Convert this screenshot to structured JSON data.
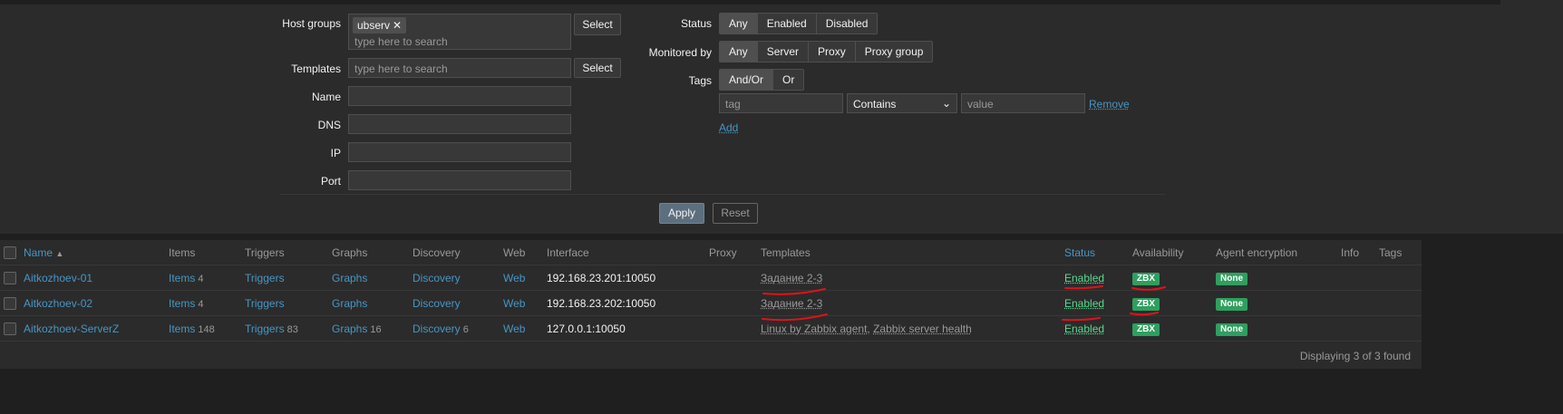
{
  "filter": {
    "host_groups_label": "Host groups",
    "host_group_chip": "ubserv",
    "chip_remove": "✕",
    "host_groups_placeholder": "type here to search",
    "templates_label": "Templates",
    "templates_placeholder": "type here to search",
    "select_label": "Select",
    "name_label": "Name",
    "dns_label": "DNS",
    "ip_label": "IP",
    "port_label": "Port",
    "status_label": "Status",
    "status_options": [
      "Any",
      "Enabled",
      "Disabled"
    ],
    "status_selected": "Any",
    "monitored_by_label": "Monitored by",
    "monitored_options": [
      "Any",
      "Server",
      "Proxy",
      "Proxy group"
    ],
    "monitored_selected": "Any",
    "tags_label": "Tags",
    "tags_options": [
      "And/Or",
      "Or"
    ],
    "tags_selected": "And/Or",
    "tag_placeholder": "tag",
    "tag_operator": "Contains",
    "value_placeholder": "value",
    "remove_label": "Remove",
    "add_label": "Add",
    "apply_label": "Apply",
    "reset_label": "Reset"
  },
  "table": {
    "headers": {
      "name": "Name",
      "sort_indicator": "▲",
      "items": "Items",
      "triggers": "Triggers",
      "graphs": "Graphs",
      "discovery": "Discovery",
      "web": "Web",
      "interface": "Interface",
      "proxy": "Proxy",
      "templates": "Templates",
      "status": "Status",
      "availability": "Availability",
      "agent_encryption": "Agent encryption",
      "info": "Info",
      "tags": "Tags"
    },
    "rows": [
      {
        "name": "Aitkozhoev-01",
        "items": "Items",
        "items_count": "4",
        "triggers": "Triggers",
        "triggers_count": "",
        "graphs": "Graphs",
        "graphs_count": "",
        "discovery": "Discovery",
        "discovery_count": "",
        "web": "Web",
        "interface": "192.168.23.201:10050",
        "templates": "Задание 2-3",
        "status": "Enabled",
        "availability": "ZBX",
        "encryption": "None"
      },
      {
        "name": "Aitkozhoev-02",
        "items": "Items",
        "items_count": "4",
        "triggers": "Triggers",
        "triggers_count": "",
        "graphs": "Graphs",
        "graphs_count": "",
        "discovery": "Discovery",
        "discovery_count": "",
        "web": "Web",
        "interface": "192.168.23.202:10050",
        "templates": "Задание 2-3",
        "status": "Enabled",
        "availability": "ZBX",
        "encryption": "None"
      },
      {
        "name": "Aitkozhoev-ServerZ",
        "items": "Items",
        "items_count": "148",
        "triggers": "Triggers",
        "triggers_count": "83",
        "graphs": "Graphs",
        "graphs_count": "16",
        "discovery": "Discovery",
        "discovery_count": "6",
        "web": "Web",
        "interface": "127.0.0.1:10050",
        "templates": "Linux by Zabbix agent",
        "templates_extra": "Zabbix server health",
        "status": "Enabled",
        "availability": "ZBX",
        "encryption": "None"
      }
    ],
    "footer": "Displaying 3 of 3 found"
  },
  "colors": {
    "background": "#2b2b2b",
    "link": "#4796c4",
    "enabled": "#59db8f",
    "badge_green": "#2f9f5f",
    "annotation_red": "#e0121a"
  }
}
